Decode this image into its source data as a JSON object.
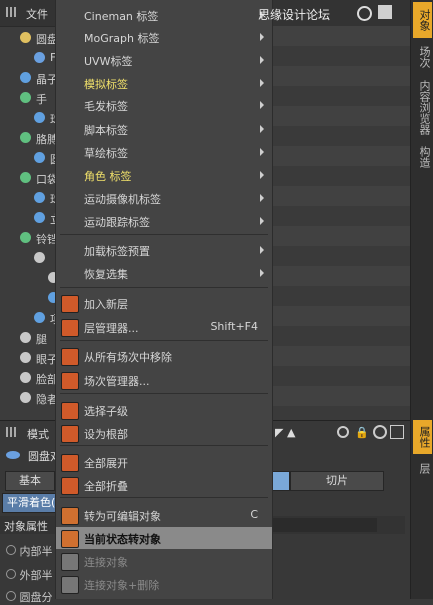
{
  "watermark": "思缘设计论坛",
  "object_manager": {
    "file_menu": "文件",
    "tree": [
      {
        "label": "圆盘",
        "color": "#e0c060"
      },
      {
        "label": "F",
        "color": "#6aa0e0"
      },
      {
        "label": "晶子",
        "color": "#60a0e0"
      },
      {
        "label": "手",
        "color": "#60c080"
      },
      {
        "label": "球",
        "color": "#60a0e0"
      },
      {
        "label": "胳膊",
        "color": "#60c080"
      },
      {
        "label": "圆",
        "color": "#60a0e0"
      },
      {
        "label": "口袋",
        "color": "#60c080"
      },
      {
        "label": "球",
        "color": "#60a0e0"
      },
      {
        "label": "立",
        "color": "#60a0e0"
      },
      {
        "label": "铃铛",
        "color": "#60c080"
      },
      {
        "label": "",
        "color": "#c8c8c8"
      },
      {
        "label": "",
        "color": "#c8c8c8"
      },
      {
        "label": "",
        "color": "#60a0e0"
      },
      {
        "label": "项圈",
        "color": "#60a0e0"
      },
      {
        "label": "腿",
        "color": "#c8c8c8"
      },
      {
        "label": "眼子",
        "color": "#c8c8c8"
      },
      {
        "label": "脸部",
        "color": "#c8c8c8"
      },
      {
        "label": "隐者",
        "color": "#c8c8c8"
      }
    ]
  },
  "attribute_panel": {
    "mode_label": "模式",
    "object_name": "圆盘对",
    "basic_tab": "基本",
    "cut_tab": "切片",
    "smooth_label": "平滑着色(",
    "section_title": "对象属性",
    "options": [
      "内部半",
      "外部半",
      "圆盘分"
    ]
  },
  "right_tabs": [
    "对象",
    "场次",
    "内容浏览器",
    "构造",
    "属性",
    "层"
  ],
  "context_menu": {
    "items": [
      {
        "label": "Cineman 标签",
        "submenu": true
      },
      {
        "label": "MoGraph 标签",
        "submenu": true
      },
      {
        "label": "UVW标签",
        "submenu": true
      },
      {
        "label": "模拟标签",
        "submenu": true,
        "highlight_text": true
      },
      {
        "label": "毛发标签",
        "submenu": true
      },
      {
        "label": "脚本标签",
        "submenu": true
      },
      {
        "label": "草绘标签",
        "submenu": true
      },
      {
        "label": "角色 标签",
        "submenu": true,
        "highlight_text": true
      },
      {
        "label": "运动摄像机标签",
        "submenu": true
      },
      {
        "label": "运动跟踪标签",
        "submenu": true
      },
      {
        "label": "加载标签预置",
        "submenu": true
      },
      {
        "label": "恢复选集",
        "submenu": true
      },
      {
        "label": "加入新层",
        "icon": "add-layer-icon"
      },
      {
        "label": "层管理器...",
        "shortcut": "Shift+F4",
        "icon": "layer-manager-icon"
      },
      {
        "label": "从所有场次中移除",
        "icon": "remove-take-icon"
      },
      {
        "label": "场次管理器...",
        "icon": "take-manager-icon"
      },
      {
        "label": "选择子级",
        "icon": "select-children-icon"
      },
      {
        "label": "设为根部",
        "icon": "set-root-icon"
      },
      {
        "label": "全部展开",
        "icon": "expand-all-icon"
      },
      {
        "label": "全部折叠",
        "icon": "collapse-all-icon"
      },
      {
        "label": "转为可编辑对象",
        "shortcut": "C",
        "icon": "make-editable-icon"
      },
      {
        "label": "当前状态转对象",
        "icon": "current-state-icon",
        "selected": true
      },
      {
        "label": "连接对象",
        "icon": "connect-icon",
        "disabled": true
      },
      {
        "label": "连接对象+删除",
        "icon": "connect-delete-icon",
        "disabled": true
      }
    ]
  }
}
